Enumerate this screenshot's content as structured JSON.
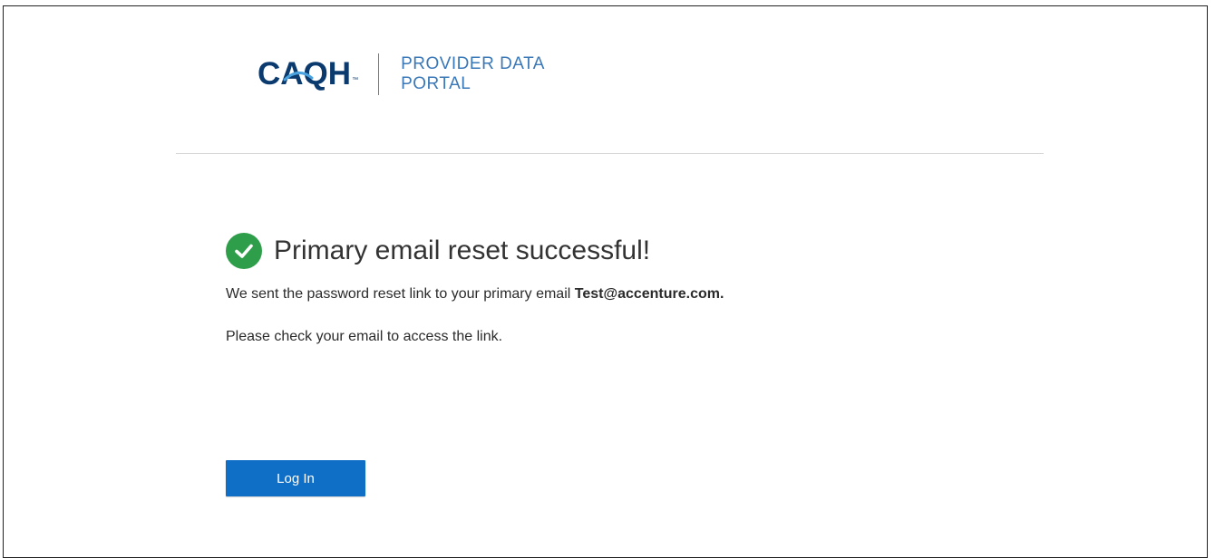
{
  "brand": {
    "logo_text": "CAQH",
    "logo_trademark": "™",
    "portal_title_line1": "PROVIDER DATA",
    "portal_title_line2": "PORTAL",
    "logo_color": "#0b3a6e",
    "accent_color": "#3b78b8"
  },
  "status": {
    "icon": "check-circle-icon",
    "icon_color": "#2e9e4a",
    "heading": "Primary email reset successful!"
  },
  "message": {
    "sent_prefix": "We sent the password reset link to your primary email ",
    "email": "Test@accenture.com.",
    "instruction": "Please check your email to access the link."
  },
  "actions": {
    "login_label": "Log In",
    "login_color": "#0f6fc6"
  }
}
